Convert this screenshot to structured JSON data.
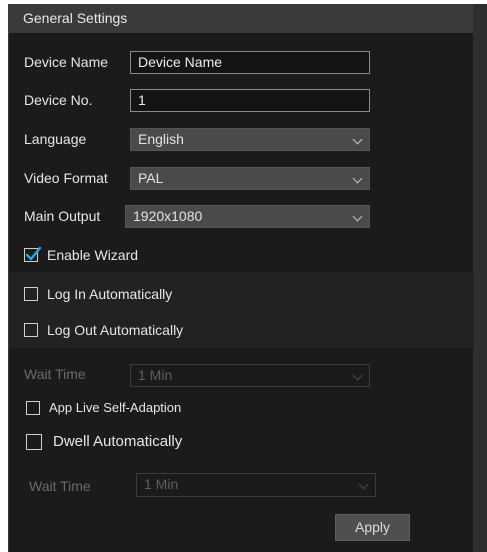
{
  "title": "General Settings",
  "fields": {
    "device_name": {
      "label": "Device Name",
      "value": "Device Name"
    },
    "device_no": {
      "label": "Device No.",
      "value": "1"
    },
    "language": {
      "label": "Language",
      "value": "English"
    },
    "video_format": {
      "label": "Video Format",
      "value": "PAL"
    },
    "main_output": {
      "label": "Main Output",
      "value": "1920x1080"
    }
  },
  "checkboxes": {
    "enable_wizard": {
      "label": "Enable Wizard",
      "checked": true
    },
    "log_in_auto": {
      "label": "Log In Automatically",
      "checked": false
    },
    "log_out_auto": {
      "label": "Log Out Automatically",
      "checked": false
    },
    "app_live": {
      "label": "App Live Self-Adaption",
      "checked": false
    },
    "dwell_auto": {
      "label": "Dwell Automatically",
      "checked": false
    }
  },
  "wait_time_1": {
    "label": "Wait Time",
    "value": "1 Min"
  },
  "wait_time_2": {
    "label": "Wait Time",
    "value": "1 Min"
  },
  "apply_label": "Apply",
  "icons": {
    "dropdown": "chevron-down-icon",
    "check": "checkmark-icon"
  },
  "colors": {
    "panel": "#1b1b1b",
    "titlebar": "#3a3a3a",
    "check": "#2aa6e0"
  }
}
